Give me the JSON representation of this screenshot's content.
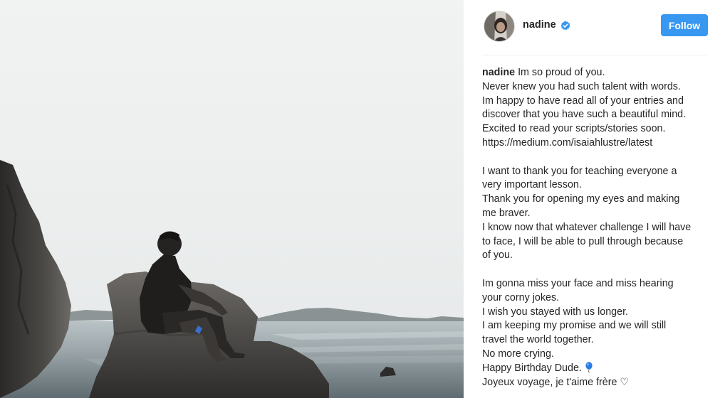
{
  "post": {
    "image_alt": "",
    "author": {
      "username": "nadine",
      "verified": true,
      "avatar_icon": "profile-avatar"
    },
    "follow_label": "Follow",
    "caption": {
      "author": "nadine",
      "lines": [
        "Im so proud of you.",
        "Never knew you had such talent with words.",
        "Im happy to have read all of your entries and",
        "discover that you have such a beautiful mind.",
        "Excited to read your scripts/stories soon.",
        "https://medium.com/isaiahlustre/latest",
        "",
        "I want to thank you for teaching everyone a",
        "very important lesson.",
        "Thank you for opening my eyes and making",
        "me braver.",
        "I know now that whatever challenge I will have",
        "to face, I will be able to pull through because",
        "of you.",
        "",
        "Im gonna miss your face and miss hearing",
        "your corny jokes.",
        "I wish you stayed with us longer.",
        "I am keeping my promise and we will still",
        "travel the world together.",
        "No more crying.",
        "Happy Birthday Dude.",
        "Joyeux voyage, je t'aime frère ♡"
      ],
      "emoji_after_line_21": "balloon-icon"
    },
    "colors": {
      "follow_button": "#3897f0",
      "verified_badge": "#3897f0",
      "text": "#262626",
      "divider": "#efefef"
    }
  }
}
